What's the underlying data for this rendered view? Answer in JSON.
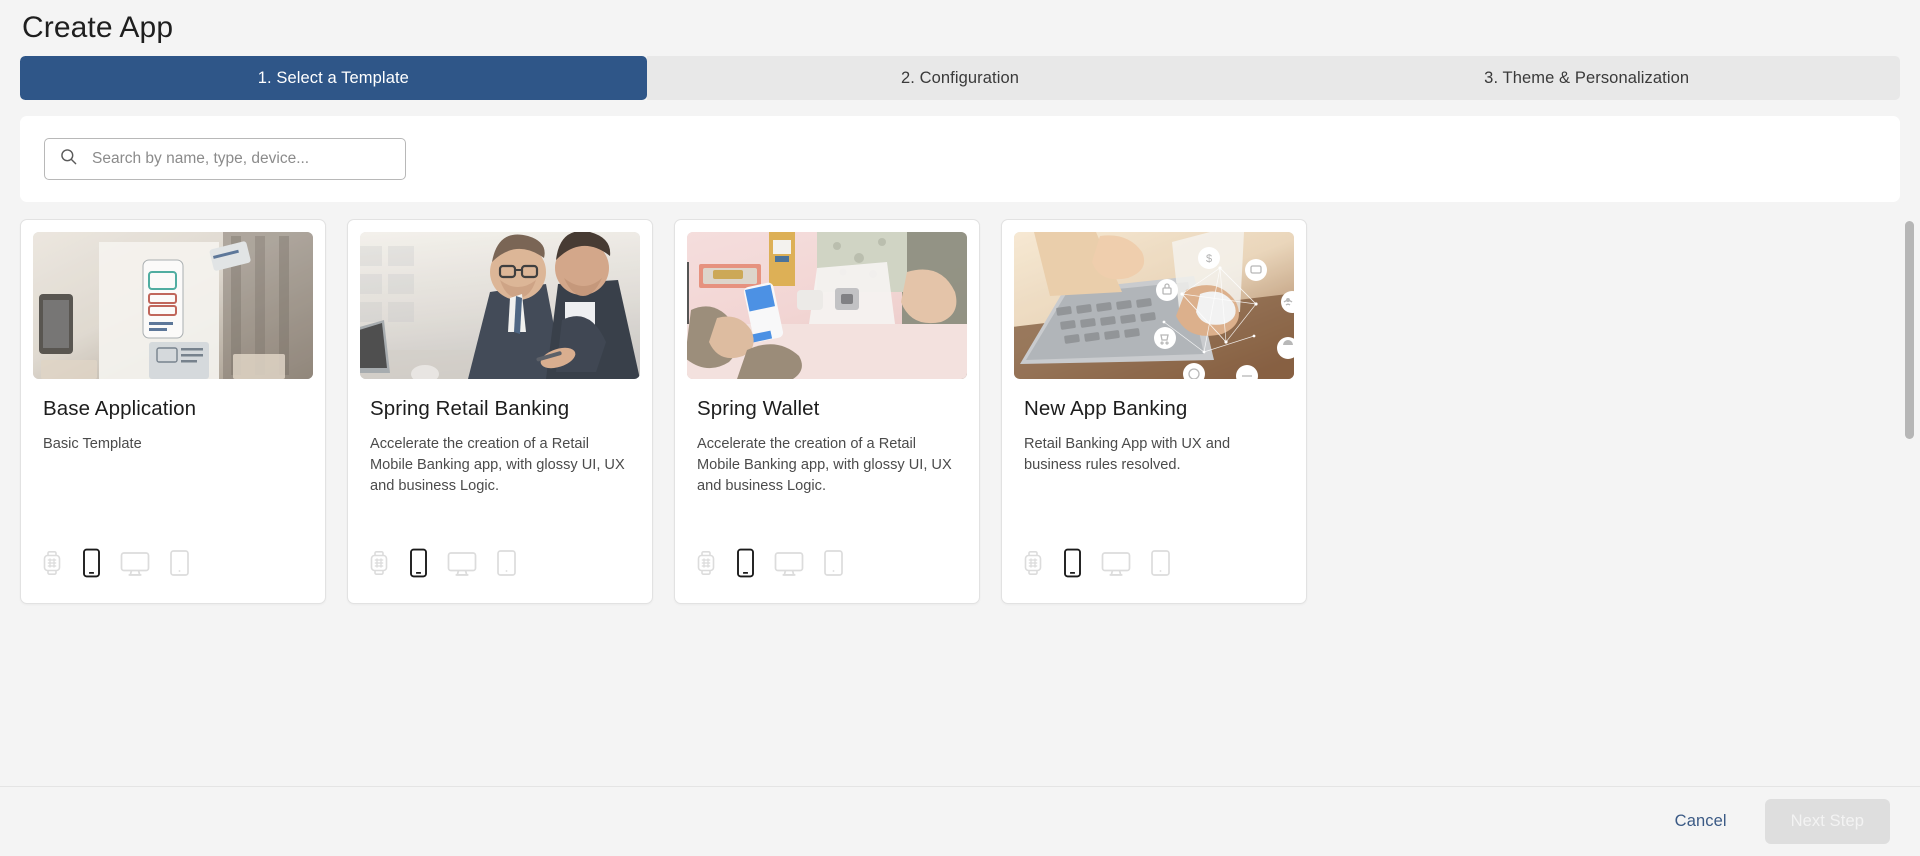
{
  "header": {
    "title": "Create App"
  },
  "tabs": [
    {
      "label": "1. Select a Template",
      "active": true
    },
    {
      "label": "2. Configuration",
      "active": false
    },
    {
      "label": "3. Theme & Personalization",
      "active": false
    }
  ],
  "search": {
    "placeholder": "Search by name, type, device...",
    "value": "",
    "icon": "search-icon"
  },
  "devices": [
    {
      "name": "smartwatch-icon",
      "label": "Smartwatch",
      "enabled": false
    },
    {
      "name": "phone-icon",
      "label": "Phone",
      "enabled": true
    },
    {
      "name": "desktop-icon",
      "label": "Desktop",
      "enabled": false
    },
    {
      "name": "tablet-icon",
      "label": "Tablet",
      "enabled": false
    }
  ],
  "cards": [
    {
      "title": "Base Application",
      "description": "Basic Template",
      "thumb": "wireframe-sketch-photo"
    },
    {
      "title": "Spring Retail Banking",
      "description": "Accelerate the creation of a Retail Mobile Banking app, with glossy UI, UX and business Logic.",
      "thumb": "two-businessmen-photo"
    },
    {
      "title": "Spring Wallet",
      "description": "Accelerate the creation of a Retail Mobile Banking app, with glossy UI, UX and business Logic.",
      "thumb": "contactless-payment-photo"
    },
    {
      "title": "New App Banking",
      "description": "Retail Banking App with UX and business rules resolved.",
      "thumb": "laptop-network-icons-photo"
    }
  ],
  "footer": {
    "cancel_label": "Cancel",
    "next_label": "Next Step"
  },
  "colors": {
    "accent": "#2f5688",
    "tab_inactive_bg": "#e8e8e8",
    "page_bg": "#f4f4f4",
    "card_bg": "#ffffff",
    "link": "#3b5a85",
    "disabled_btn_bg": "#dedede"
  }
}
